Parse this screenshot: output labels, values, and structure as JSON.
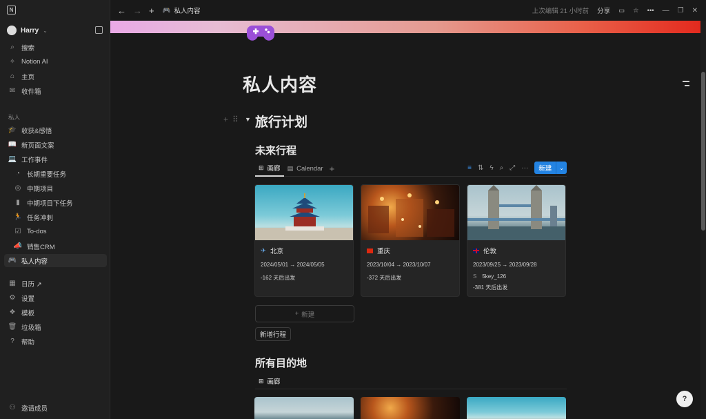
{
  "workspace": {
    "name": "Harry"
  },
  "sidebar": {
    "top": [
      {
        "icon": "search-icon",
        "glyph": "⌕",
        "label": "搜索"
      },
      {
        "icon": "notion-ai-icon",
        "glyph": "✧",
        "label": "Notion AI"
      },
      {
        "icon": "home-icon",
        "glyph": "⌂",
        "label": "主页"
      },
      {
        "icon": "inbox-icon",
        "glyph": "✉",
        "label": "收件箱"
      }
    ],
    "section_label": "私人",
    "private": [
      {
        "icon": "graduation-icon",
        "glyph": "🎓",
        "label": "收获&感悟"
      },
      {
        "icon": "book-icon",
        "glyph": "📖",
        "label": "新页面文案"
      },
      {
        "icon": "laptop-icon",
        "glyph": "💻",
        "label": "工作事件"
      },
      {
        "icon": "pie-icon",
        "glyph": "◔",
        "label": "长期重要任务"
      },
      {
        "icon": "target-icon",
        "glyph": "◎",
        "label": "中期项目"
      },
      {
        "icon": "blue-book-icon",
        "glyph": "▮",
        "label": "中期项目下任务"
      },
      {
        "icon": "runner-icon",
        "glyph": "🏃",
        "label": "任务冲刺"
      },
      {
        "icon": "checkbox-icon",
        "glyph": "☑",
        "label": "To-dos"
      },
      {
        "icon": "megaphone-icon",
        "glyph": "📣",
        "label": "销售CRM"
      },
      {
        "icon": "gamepad-icon",
        "glyph": "🎮",
        "label": "私人内容"
      }
    ],
    "bottom": [
      {
        "icon": "calendar-icon",
        "glyph": "▦",
        "label": "日历 ↗"
      },
      {
        "icon": "settings-icon",
        "glyph": "⚙",
        "label": "设置"
      },
      {
        "icon": "templates-icon",
        "glyph": "❖",
        "label": "模板"
      },
      {
        "icon": "trash-icon",
        "glyph": "🗑",
        "label": "垃圾箱"
      },
      {
        "icon": "help-icon",
        "glyph": "?",
        "label": "帮助"
      }
    ],
    "invite": "邀请成员"
  },
  "topbar": {
    "breadcrumb": "私人内容",
    "edited": "上次编辑 21 小时前",
    "share": "分享"
  },
  "page": {
    "title": "私人内容",
    "h_travel": "旅行计划",
    "h_future": "未来行程",
    "h_all": "所有目的地"
  },
  "views": {
    "gallery": "画廊",
    "calendar": "Calendar",
    "new": "新建"
  },
  "cards": [
    {
      "name": "北京",
      "flag_icon": "airplane-icon",
      "date": "2024/05/01 → 2024/05/05",
      "countdown": "-162 天后出发"
    },
    {
      "name": "重庆",
      "flag_icon": "china-flag-icon",
      "date": "2023/10/04 → 2023/10/07",
      "countdown": "-372 天后出发"
    },
    {
      "name": "伦敦",
      "flag_icon": "uk-flag-icon",
      "date": "2023/09/25 → 2023/09/28",
      "prop_key": "S",
      "prop_value": "5key_126",
      "countdown": "-381 天后出发"
    }
  ],
  "new_row": "新建",
  "add_trip": "新增行程",
  "colors": {
    "accent": "#2383e2",
    "sidebar_bg": "#202020",
    "page_bg": "#191919"
  }
}
